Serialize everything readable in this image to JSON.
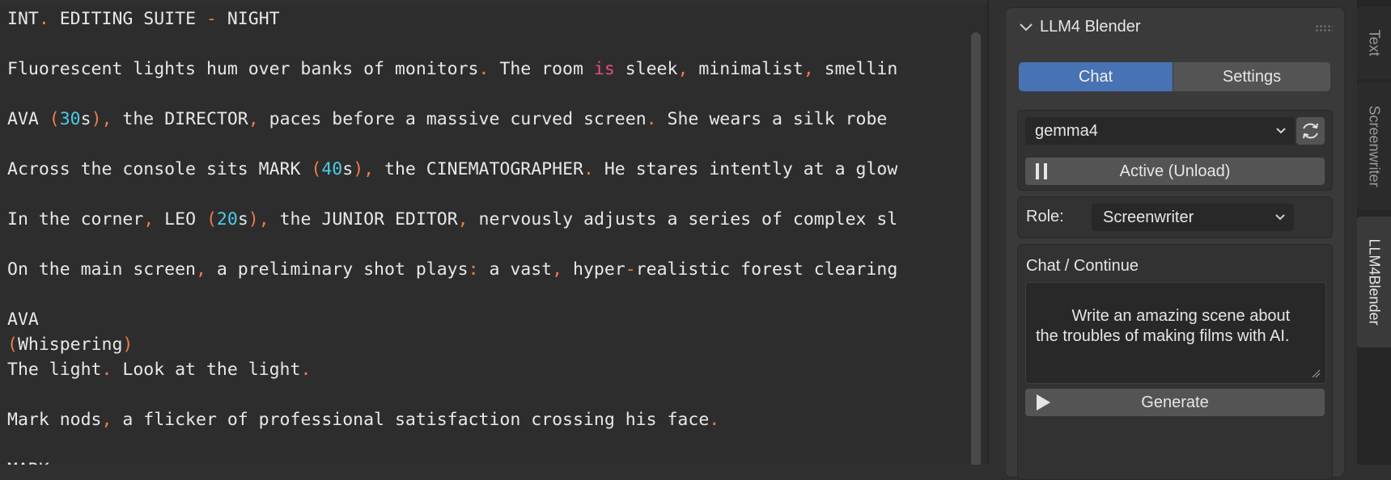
{
  "editor": {
    "lines": [
      [
        {
          "t": "INT"
        },
        {
          "t": ".",
          "c": "op"
        },
        {
          "t": " EDITING SUITE "
        },
        {
          "t": "-",
          "c": "op"
        },
        {
          "t": " NIGHT"
        }
      ],
      [],
      [
        {
          "t": "Fluorescent lights hum over banks of monitors"
        },
        {
          "t": ".",
          "c": "op"
        },
        {
          "t": " The room "
        },
        {
          "t": "is",
          "c": "kw"
        },
        {
          "t": " sleek"
        },
        {
          "t": ",",
          "c": "op"
        },
        {
          "t": " minimalist"
        },
        {
          "t": ",",
          "c": "op"
        },
        {
          "t": " smellin"
        }
      ],
      [],
      [
        {
          "t": "AVA "
        },
        {
          "t": "(",
          "c": "op"
        },
        {
          "t": "30",
          "c": "num"
        },
        {
          "t": "s"
        },
        {
          "t": "),",
          "c": "op"
        },
        {
          "t": " the DIRECTOR"
        },
        {
          "t": ",",
          "c": "op"
        },
        {
          "t": " paces before a massive curved screen"
        },
        {
          "t": ".",
          "c": "op"
        },
        {
          "t": " She wears a silk robe"
        }
      ],
      [],
      [
        {
          "t": "Across the console sits MARK "
        },
        {
          "t": "(",
          "c": "op"
        },
        {
          "t": "40",
          "c": "num"
        },
        {
          "t": "s"
        },
        {
          "t": "),",
          "c": "op"
        },
        {
          "t": " the CINEMATOGRAPHER"
        },
        {
          "t": ".",
          "c": "op"
        },
        {
          "t": " He stares intently at a glow"
        }
      ],
      [],
      [
        {
          "t": "In the corner"
        },
        {
          "t": ",",
          "c": "op"
        },
        {
          "t": " LEO "
        },
        {
          "t": "(",
          "c": "op"
        },
        {
          "t": "20",
          "c": "num"
        },
        {
          "t": "s"
        },
        {
          "t": "),",
          "c": "op"
        },
        {
          "t": " the JUNIOR EDITOR"
        },
        {
          "t": ",",
          "c": "op"
        },
        {
          "t": " nervously adjusts a series of complex sl"
        }
      ],
      [],
      [
        {
          "t": "On the main screen"
        },
        {
          "t": ",",
          "c": "op"
        },
        {
          "t": " a preliminary shot plays"
        },
        {
          "t": ":",
          "c": "op"
        },
        {
          "t": " a vast"
        },
        {
          "t": ",",
          "c": "op"
        },
        {
          "t": " hyper"
        },
        {
          "t": "-",
          "c": "op"
        },
        {
          "t": "realistic forest clearing"
        }
      ],
      [],
      [
        {
          "t": "AVA"
        }
      ],
      [
        {
          "t": "(",
          "c": "op"
        },
        {
          "t": "Whispering"
        },
        {
          "t": ")",
          "c": "op"
        }
      ],
      [
        {
          "t": "The light"
        },
        {
          "t": ".",
          "c": "op"
        },
        {
          "t": " Look at the light"
        },
        {
          "t": ".",
          "c": "op"
        }
      ],
      [],
      [
        {
          "t": "Mark nods"
        },
        {
          "t": ",",
          "c": "op"
        },
        {
          "t": " a flicker of professional satisfaction crossing his face"
        },
        {
          "t": ".",
          "c": "op"
        }
      ],
      [],
      [
        {
          "t": "MARK"
        }
      ]
    ]
  },
  "panel": {
    "title": "LLM4 Blender",
    "tabs": {
      "chat": "Chat",
      "settings": "Settings"
    },
    "model": "gemma4",
    "active_button": "Active (Unload)",
    "role_label": "Role:",
    "role_value": "Screenwriter",
    "chat_label": "Chat / Continue",
    "prompt_text": "Write an amazing scene about the troubles of making films with AI.",
    "generate_button": "Generate"
  },
  "vertical_tabs": {
    "text": "Text",
    "screenwriter": "Screenwriter",
    "llm4blender": "LLM4Blender",
    "active": "LLM4Blender"
  },
  "colors": {
    "accent": "#4772b3",
    "syntax_operator": "#ee7c4d",
    "syntax_number": "#4ccbe8",
    "syntax_keyword": "#e94b82",
    "editor_text": "#e8e8e8"
  },
  "icons": [
    "collapse-chevron-icon",
    "drag-handle-icon",
    "dropdown-chevron-icon",
    "refresh-icon",
    "pause-icon",
    "play-icon",
    "resize-grip-icon"
  ]
}
